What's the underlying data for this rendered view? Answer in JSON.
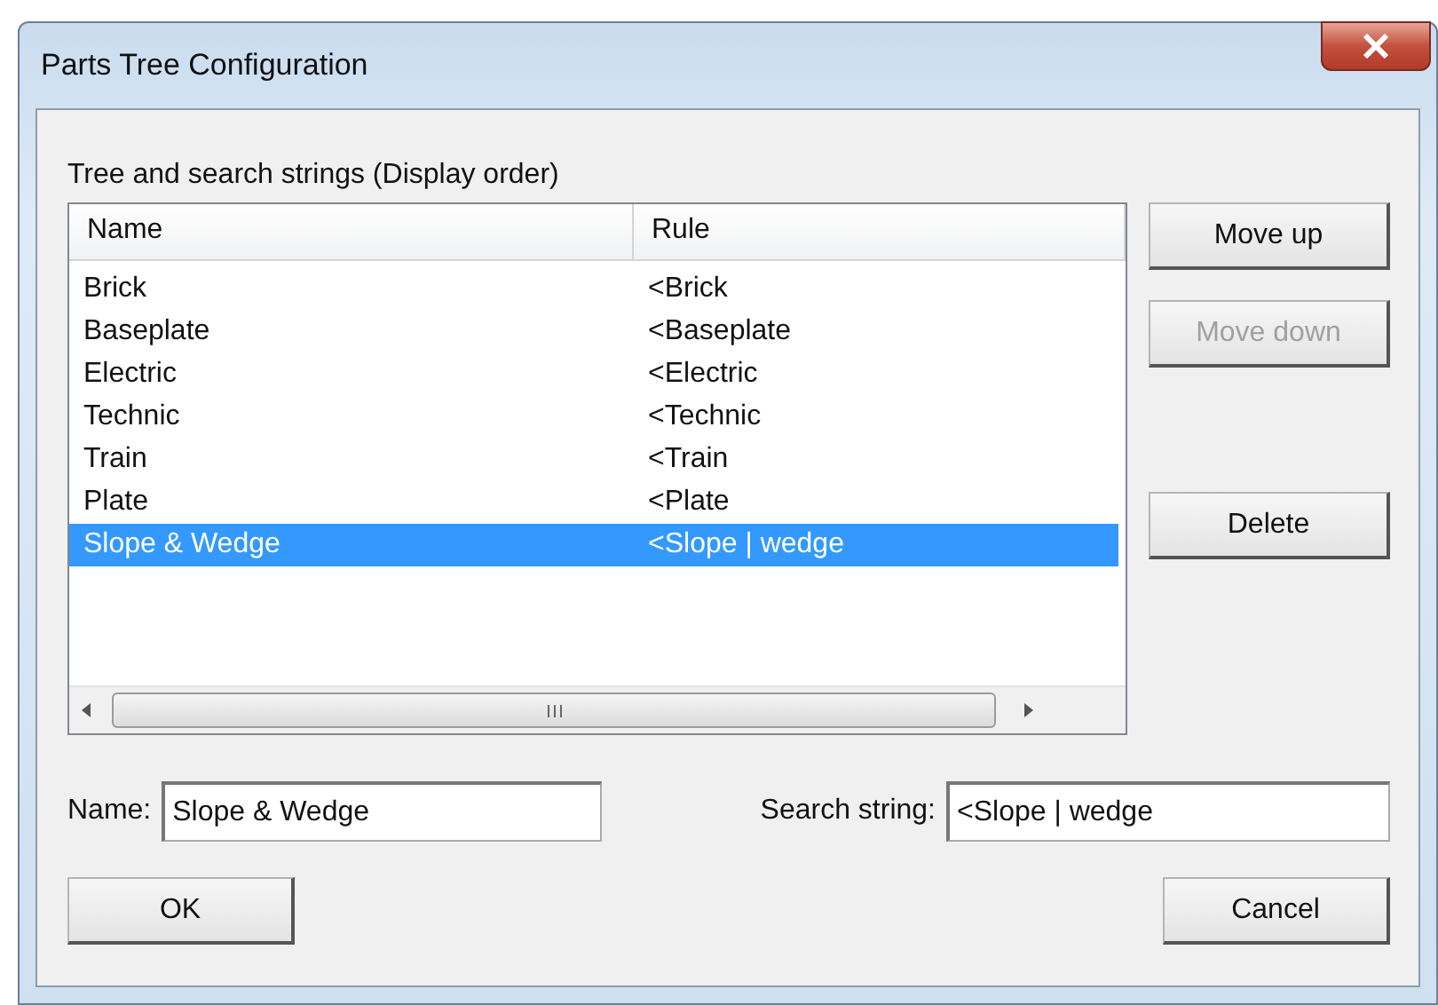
{
  "window": {
    "title": "Parts Tree Configuration"
  },
  "list_label": "Tree and search strings (Display order)",
  "table": {
    "columns": [
      "Name",
      "Rule"
    ],
    "rows": [
      {
        "name": "Brick",
        "rule": "<Brick",
        "selected": false
      },
      {
        "name": "Baseplate",
        "rule": "<Baseplate",
        "selected": false
      },
      {
        "name": "Electric",
        "rule": "<Electric",
        "selected": false
      },
      {
        "name": "Technic",
        "rule": "<Technic",
        "selected": false
      },
      {
        "name": "Train",
        "rule": "<Train",
        "selected": false
      },
      {
        "name": "Plate",
        "rule": "<Plate",
        "selected": false
      },
      {
        "name": "Slope & Wedge",
        "rule": "<Slope | wedge",
        "selected": true
      }
    ]
  },
  "side_buttons": [
    {
      "label": "Move up",
      "disabled": false
    },
    {
      "label": "Move down",
      "disabled": true
    },
    {
      "label": "Delete",
      "disabled": false
    }
  ],
  "name_field": {
    "label": "Name:",
    "value": "Slope & Wedge"
  },
  "search_field": {
    "label": "Search string:",
    "value": "<Slope | wedge"
  },
  "buttons": [
    "OK",
    "Cancel"
  ]
}
